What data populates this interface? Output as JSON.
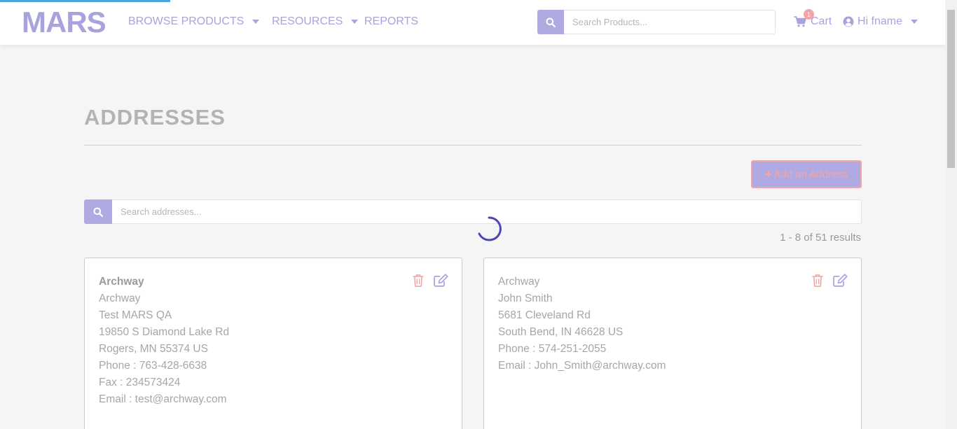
{
  "brand": {
    "logo_text": "MARS"
  },
  "nav": {
    "browse_products": "BROWSE PRODUCTS",
    "resources": "RESOURCES",
    "reports": "REPORTS"
  },
  "header_search": {
    "placeholder": "Search Products..."
  },
  "cart": {
    "label": "Cart",
    "count": "1"
  },
  "user": {
    "greeting": "Hi fname"
  },
  "page": {
    "title": "ADDRESSES",
    "add_button_label": "Add an Address",
    "search_placeholder": "Search addresses...",
    "results_text": "1 - 8 of 51 results"
  },
  "addresses": [
    {
      "title": "Archway",
      "title_bold": true,
      "lines": [
        "Archway",
        "Test MARS QA",
        "19850 S Diamond Lake Rd",
        "Rogers, MN 55374 US",
        "Phone : 763-428-6638",
        "Fax : 234573424",
        "Email : test@archway.com"
      ]
    },
    {
      "title": "Archway",
      "title_bold": false,
      "lines": [
        "John Smith",
        "5681 Cleveland Rd",
        "South Bend, IN 46628 US",
        "Phone : 574-251-2055",
        "Email : John_Smith@archway.com"
      ]
    }
  ],
  "colors": {
    "accent": "#a9a3dd",
    "accent_button": "#b0aae2",
    "danger": "#f4a3a6",
    "spinner": "#4b45b5",
    "progress": "#4aa3df"
  }
}
